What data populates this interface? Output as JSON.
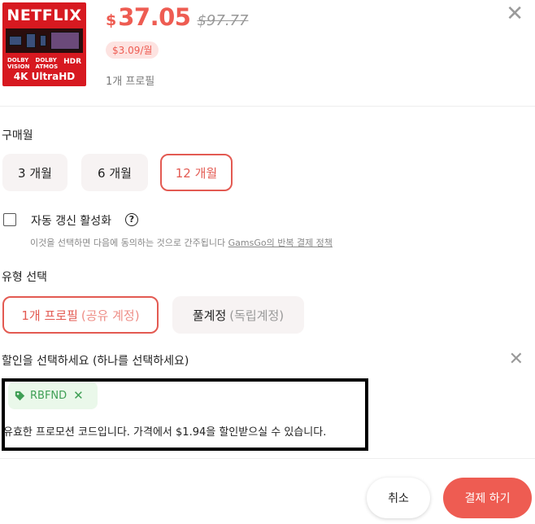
{
  "product": {
    "brand": "NETFLIX",
    "badges": [
      "DOLBY VISION",
      "DOLBY ATMOS",
      "HDR"
    ],
    "quality": "4K UltraHD",
    "currency": "$",
    "price": "37.05",
    "original_price": "$97.77",
    "per_month": "$3.09/월",
    "profile_note": "1개 프로필"
  },
  "purchase_month": {
    "title": "구매월",
    "options": [
      {
        "label": "3 개월",
        "selected": false
      },
      {
        "label": "6 개월",
        "selected": false
      },
      {
        "label": "12 개월",
        "selected": true
      }
    ]
  },
  "auto_renew": {
    "label": "자동 갱신 활성화",
    "checked": false,
    "help_icon": "question-circle-icon",
    "terms_prefix": "이것을 선택하면 다음에 동의하는 것으로 간주됩니다",
    "terms_link": "GamsGo의 반복 결제 정책"
  },
  "type_select": {
    "title": "유형 선택",
    "options": [
      {
        "main": "1개 프로필",
        "sub": "(공유 계정)",
        "selected": true
      },
      {
        "main": "풀계정",
        "sub": "(독립계정)",
        "selected": false
      }
    ]
  },
  "discount": {
    "title": "할인을 선택하세요 (하나를 선택하세요)",
    "coupon_code": "RBFND",
    "message": "유효한 프로모션 코드입니다. 가격에서 $1.94을 할인받으실 수 있습니다."
  },
  "actions": {
    "cancel": "취소",
    "pay": "결제 하기"
  },
  "colors": {
    "accent": "#ee5c52",
    "coupon_green": "#3f9f55",
    "netflix_red": "#d71920"
  }
}
